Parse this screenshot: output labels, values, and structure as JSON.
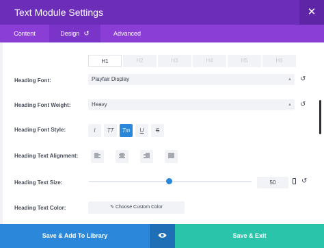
{
  "window": {
    "title": "Text Module Settings",
    "close_icon": "close-icon"
  },
  "tabs": [
    {
      "label": "Content"
    },
    {
      "label": "Design",
      "icon": "reset-icon"
    },
    {
      "label": "Advanced"
    }
  ],
  "heading_tabs": [
    "H1",
    "H2",
    "H3",
    "H4",
    "H5",
    "H6"
  ],
  "active_heading_tab": "H1",
  "settings": {
    "heading_font": {
      "label": "Heading Font:",
      "value": "Playfair Display"
    },
    "heading_font_weight": {
      "label": "Heading Font Weight:",
      "value": "Heavy"
    },
    "heading_font_style": {
      "label": "Heading Font Style:",
      "options": [
        "I",
        "TT",
        "Tт",
        "U",
        "S"
      ],
      "active": "Tт"
    },
    "heading_text_alignment": {
      "label": "Heading Text Alignment:",
      "options": [
        "align-left-icon",
        "align-center-icon",
        "align-right-icon",
        "align-justify-icon"
      ]
    },
    "heading_text_size": {
      "label": "Heading Text Size:",
      "value": "50"
    },
    "heading_text_color": {
      "label": "Heading Text Color:",
      "button_label": "Choose Custom Color"
    }
  },
  "footer": {
    "save_library": "Save & Add To Library",
    "save_exit": "Save & Exit",
    "preview_icon": "eye-icon"
  },
  "colors": {
    "purple": "#6c2eb9",
    "tab_purple": "#8a3ed6",
    "blue": "#2b87da",
    "teal": "#29c4a9"
  }
}
